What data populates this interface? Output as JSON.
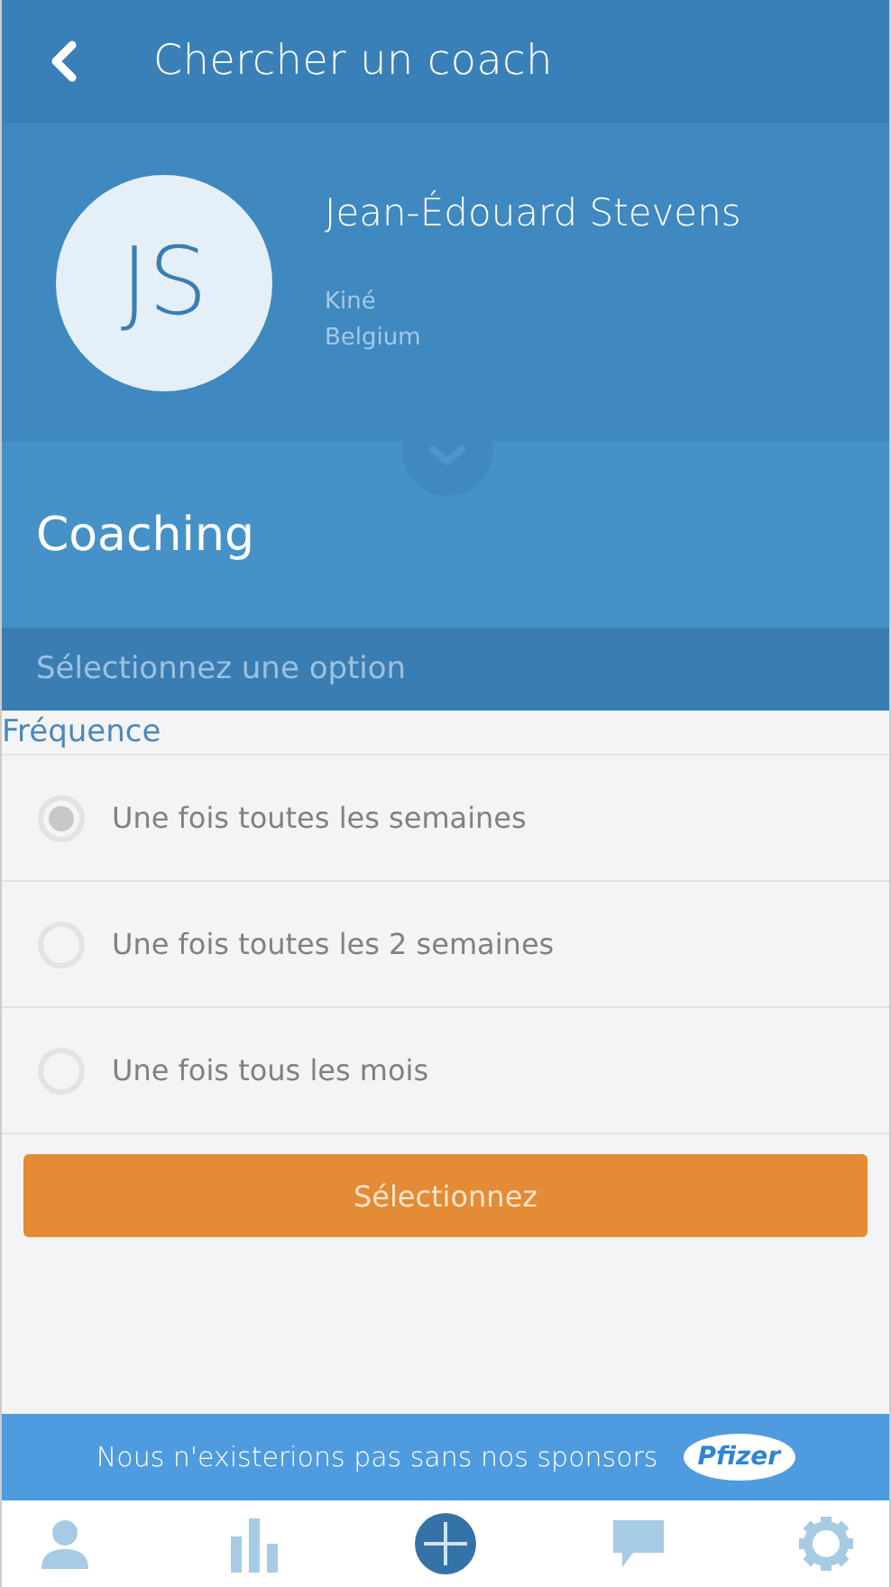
{
  "header": {
    "title": "Chercher un coach"
  },
  "coach": {
    "initials": "JS",
    "name": "Jean-Édouard Stevens",
    "profession": "Kiné",
    "country": "Belgium"
  },
  "section": {
    "title": "Coaching",
    "prompt": "Sélectionnez une option"
  },
  "field": {
    "label": "Fréquence",
    "options": [
      {
        "label": "Une fois toutes les semaines",
        "selected": true
      },
      {
        "label": "Une fois toutes les 2 semaines",
        "selected": false
      },
      {
        "label": "Une fois tous les mois",
        "selected": false
      }
    ]
  },
  "submit": "Sélectionnez",
  "sponsor": {
    "text": "Nous n'existerions pas sans nos sponsors",
    "logo": "Pfizer"
  },
  "tabs": [
    {
      "kind": "profile",
      "selected": false
    },
    {
      "kind": "stats",
      "selected": false
    },
    {
      "kind": "add",
      "selected": true
    },
    {
      "kind": "chat",
      "selected": false
    },
    {
      "kind": "settings",
      "selected": false
    }
  ]
}
